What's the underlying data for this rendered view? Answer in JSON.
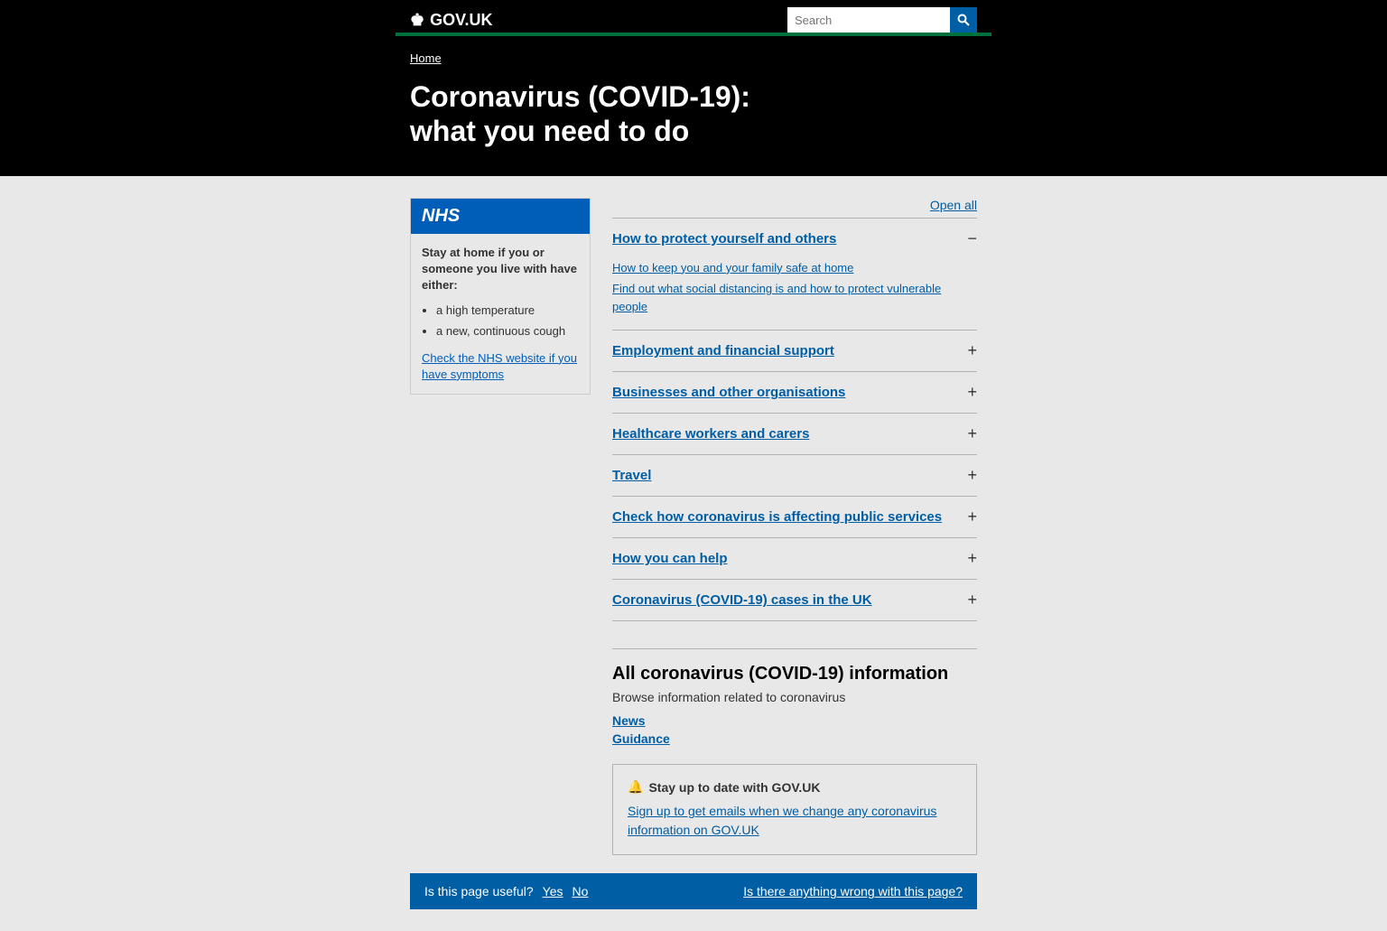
{
  "header": {
    "logo_text": "GOV.UK",
    "search_placeholder": "Search",
    "search_button_label": "Search"
  },
  "breadcrumb": {
    "home_label": "Home",
    "home_href": "#"
  },
  "hero": {
    "title_line1": "Coronavirus (COVID-19):",
    "title_line2": "what you need to do"
  },
  "nhs_box": {
    "label": "NHS",
    "stay_home_text": "Stay at home if you or someone you live with have either:",
    "symptoms": [
      "a high temperature",
      "a new, continuous cough"
    ],
    "check_link_text": "Check the NHS website if you have symptoms",
    "check_link_href": "#"
  },
  "accordion": {
    "open_all_label": "Open all",
    "items": [
      {
        "id": "protect",
        "title": "How to protect yourself and others",
        "open": true,
        "icon": "−",
        "links": [
          {
            "text": "How to keep you and your family safe at home",
            "href": "#"
          },
          {
            "text": "Find out what social distancing is and how to protect vulnerable people",
            "href": "#"
          }
        ]
      },
      {
        "id": "employment",
        "title": "Employment and financial support",
        "open": false,
        "icon": "+",
        "links": []
      },
      {
        "id": "businesses",
        "title": "Businesses and other organisations",
        "open": false,
        "icon": "+",
        "links": []
      },
      {
        "id": "healthcare",
        "title": "Healthcare workers and carers",
        "open": false,
        "icon": "+",
        "links": []
      },
      {
        "id": "travel",
        "title": "Travel",
        "open": false,
        "icon": "+",
        "links": []
      },
      {
        "id": "public-services",
        "title": "Check how coronavirus is affecting public services",
        "open": false,
        "icon": "+",
        "links": []
      },
      {
        "id": "help",
        "title": "How you can help",
        "open": false,
        "icon": "+",
        "links": []
      },
      {
        "id": "cases",
        "title": "Coronavirus (COVID-19) cases in the UK",
        "open": false,
        "icon": "+",
        "links": []
      }
    ]
  },
  "all_covid": {
    "title": "All coronavirus (COVID-19) information",
    "description": "Browse information related to coronavirus",
    "links": [
      {
        "text": "News",
        "href": "#"
      },
      {
        "text": "Guidance",
        "href": "#"
      }
    ]
  },
  "stay_updated": {
    "title": "Stay up to date with GOV.UK",
    "link_text": "Sign up to get emails when we change any coronavirus information on GOV.UK",
    "link_href": "#"
  },
  "feedback": {
    "question": "Is this page useful?",
    "yes_label": "Yes",
    "no_label": "No",
    "wrong_label": "Is there anything wrong with this page?"
  }
}
